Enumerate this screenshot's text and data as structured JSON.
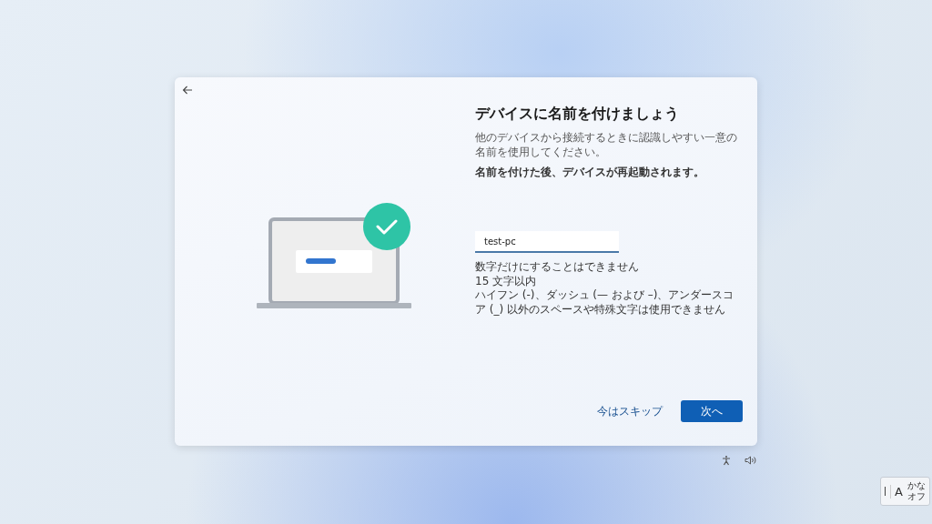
{
  "dialog": {
    "title": "デバイスに名前を付けましょう",
    "description": "他のデバイスから接続するときに認識しやすい一意の名前を使用してください。",
    "notice": "名前を付けた後、デバイスが再起動されます。",
    "name_field": {
      "value": "test-pc"
    },
    "rules": [
      "数字だけにすることはできません",
      "15 文字以内",
      "ハイフン (-)、ダッシュ (— および –)、アンダースコア (_) 以外のスペースや特殊文字は使用できません"
    ],
    "skip_button": "今はスキップ",
    "next_button": "次へ"
  },
  "ime": {
    "mode": "A",
    "kana": "かな",
    "off": "オフ"
  }
}
